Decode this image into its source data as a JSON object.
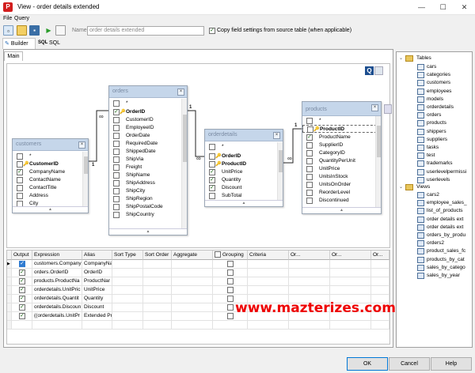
{
  "window": {
    "title": "View - order details extended",
    "app_icon_letter": "P"
  },
  "menu": [
    "File",
    "Query"
  ],
  "toolbar": {
    "name_label": "Name",
    "name_value": "order details extended",
    "copy_settings_label": "Copy field settings from source table (when applicable)",
    "copy_settings_checked": true
  },
  "mode_tabs": [
    "Builder",
    "SQL",
    "SQL"
  ],
  "main_tab": "Main",
  "tables": {
    "customers": {
      "name": "customers",
      "fields": [
        "*",
        "CustomerID",
        "CompanyName",
        "ContactName",
        "ContactTitle",
        "Address",
        "City"
      ]
    },
    "orders": {
      "name": "orders",
      "fields": [
        "*",
        "OrderID",
        "CustomerID",
        "EmployeeID",
        "OrderDate",
        "RequiredDate",
        "ShippedDate",
        "ShipVia",
        "Freight",
        "ShipName",
        "ShipAddress",
        "ShipCity",
        "ShipRegion",
        "ShipPostalCode",
        "ShipCountry"
      ]
    },
    "orderdetails": {
      "name": "orderdetails",
      "fields": [
        "*",
        "OrderID",
        "ProductID",
        "UnitPrice",
        "Quantity",
        "Discount",
        "SubTotal"
      ]
    },
    "products": {
      "name": "products",
      "fields": [
        "*",
        "ProductID",
        "ProductName",
        "SupplierID",
        "CategoryID",
        "QuantityPerUnit",
        "UnitPrice",
        "UnitsInStock",
        "UnitsOnOrder",
        "ReorderLevel",
        "Discontinued"
      ]
    }
  },
  "relations": {
    "one": "1",
    "many": "∞"
  },
  "grid": {
    "headers": [
      "Output",
      "Expression",
      "Alias",
      "Sort Type",
      "Sort Order",
      "Aggregate",
      "Grouping",
      "Criteria",
      "Or...",
      "Or...",
      "Or..."
    ],
    "rows": [
      {
        "expression": "customers.CompanyN",
        "alias": "CompanyNa"
      },
      {
        "expression": "orders.OrderID",
        "alias": "OrderID"
      },
      {
        "expression": "products.ProductNa",
        "alias": "ProductNar"
      },
      {
        "expression": "orderdetails.UnitPric",
        "alias": "UnitPrice"
      },
      {
        "expression": "orderdetails.Quantit",
        "alias": "Quantity"
      },
      {
        "expression": "orderdetails.Discoun",
        "alias": "Discount"
      },
      {
        "expression": "((orderdetails.UnitPr",
        "alias": "Extended Pr"
      },
      {
        "expression": "",
        "alias": ""
      }
    ]
  },
  "tree": {
    "tables_label": "Tables",
    "tables": [
      "cars",
      "categories",
      "customers",
      "employees",
      "models",
      "orderdetails",
      "orders",
      "products",
      "shippers",
      "suppliers",
      "tasks",
      "test",
      "trademarks",
      "userlevelpermissi",
      "userlevels"
    ],
    "views_label": "Views",
    "views": [
      "cars2",
      "employee_sales_",
      "list_of_products",
      "order details ext",
      "order details ext",
      "orders_by_produ",
      "orders2",
      "product_sales_fc",
      "products_by_cat",
      "sales_by_catego",
      "sales_by_year"
    ]
  },
  "watermark": "www.mazterizes.com",
  "buttons": {
    "ok": "OK",
    "cancel": "Cancel",
    "help": "Help"
  }
}
